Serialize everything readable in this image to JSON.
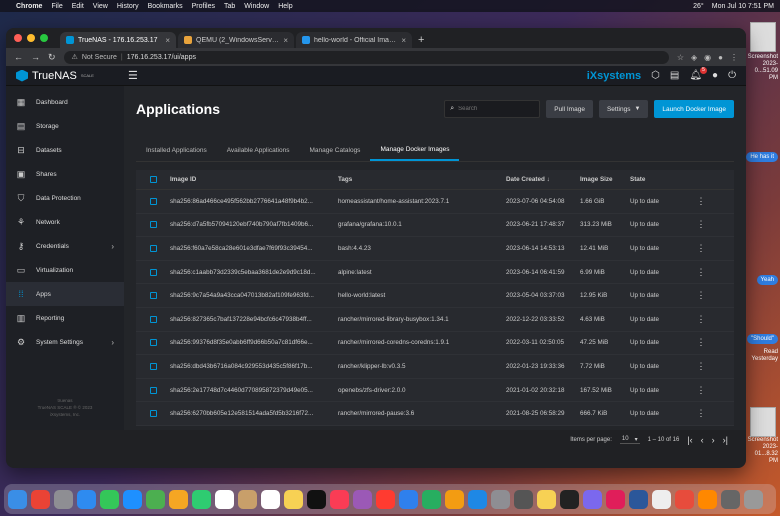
{
  "menubar": {
    "app": "Chrome",
    "items": [
      "File",
      "Edit",
      "View",
      "History",
      "Bookmarks",
      "Profiles",
      "Tab",
      "Window",
      "Help"
    ],
    "temperature": "26°",
    "datetime": "Mon Jul 10 7:51 PM"
  },
  "desktop": {
    "labels": [
      "Screenshot 2023-0...51.09 PM",
      "Screenshot 2023-01...8.32 PM"
    ],
    "chat": [
      "He has it",
      "Yeah",
      "\"Should\"",
      "Read Yesterday"
    ]
  },
  "browser": {
    "tabs": [
      {
        "label": "TrueNAS - 176.16.253.17",
        "active": true
      },
      {
        "label": "QEMU (2_WindowsServer2022...",
        "active": false
      },
      {
        "label": "hello-world - Official Image | D...",
        "active": false
      }
    ],
    "url_security": "Not Secure",
    "url": "176.16.253.17/ui/apps"
  },
  "header": {
    "logo_name": "TrueNAS",
    "logo_sub": "SCALE",
    "brand": "iXsystems",
    "notifications_count": "5"
  },
  "sidebar": {
    "items": [
      {
        "label": "Dashboard",
        "icon": "dashboard-icon"
      },
      {
        "label": "Storage",
        "icon": "storage-icon"
      },
      {
        "label": "Datasets",
        "icon": "datasets-icon"
      },
      {
        "label": "Shares",
        "icon": "shares-icon"
      },
      {
        "label": "Data Protection",
        "icon": "shield-icon"
      },
      {
        "label": "Network",
        "icon": "network-icon"
      },
      {
        "label": "Credentials",
        "icon": "key-icon"
      },
      {
        "label": "Virtualization",
        "icon": "monitor-icon"
      },
      {
        "label": "Apps",
        "icon": "apps-icon"
      },
      {
        "label": "Reporting",
        "icon": "chart-icon"
      },
      {
        "label": "System Settings",
        "icon": "gear-icon"
      }
    ],
    "footer_host": "truenas",
    "footer_version": "TrueNAS SCALE ® © 2023",
    "footer_company": "iXsystems, Inc."
  },
  "main": {
    "title": "Applications",
    "search_placeholder": "Search",
    "pull_image": "Pull Image",
    "settings": "Settings",
    "launch": "Launch Docker Image",
    "tabs": [
      "Installed Applications",
      "Available Applications",
      "Manage Catalogs",
      "Manage Docker Images"
    ],
    "columns": [
      "Image ID",
      "Tags",
      "Date Created",
      "Image Size",
      "State"
    ],
    "rows": [
      {
        "id": "sha256:86ad466ce495f562bb2776641a48f9b4b2...",
        "tags": "homeassistant/home-assistant:2023.7.1",
        "date": "2023-07-06 04:54:08",
        "size": "1.66 GiB",
        "state": "Up to date"
      },
      {
        "id": "sha256:d7a5fb57094120ebf740b790af7fb1409b6...",
        "tags": "grafana/grafana:10.0.1",
        "date": "2023-06-21 17:48:37",
        "size": "313.23 MiB",
        "state": "Up to date"
      },
      {
        "id": "sha256:f60a7e58ca28e601e3dfae7f69f93c39454...",
        "tags": "bash:4.4.23",
        "date": "2023-06-14 14:53:13",
        "size": "12.41 MiB",
        "state": "Up to date"
      },
      {
        "id": "sha256:c1aabb73d2339c5ebaa3681de2e9d9c18d...",
        "tags": "alpine:latest",
        "date": "2023-06-14 06:41:59",
        "size": "6.99 MiB",
        "state": "Up to date"
      },
      {
        "id": "sha256:9c7a54a9a43cca047013b82af109fe963fd...",
        "tags": "hello-world:latest",
        "date": "2023-05-04 03:37:03",
        "size": "12.95 KiB",
        "state": "Up to date"
      },
      {
        "id": "sha256:827365c7baf137228e94bcfc6c47938b4ff...",
        "tags": "rancher/mirrored-library-busybox:1.34.1",
        "date": "2022-12-22 03:33:52",
        "size": "4.63 MiB",
        "state": "Up to date"
      },
      {
        "id": "sha256:99376d8f35e0abb6ff9d66b50a7c81df66e...",
        "tags": "rancher/mirrored-coredns-coredns:1.9.1",
        "date": "2022-03-11 02:50:05",
        "size": "47.25 MiB",
        "state": "Up to date"
      },
      {
        "id": "sha256:dbd43b6716a084c929553d435c5f86f17b...",
        "tags": "rancher/klipper-lb:v0.3.5",
        "date": "2022-01-23 19:33:36",
        "size": "7.72 MiB",
        "state": "Up to date"
      },
      {
        "id": "sha256:2e17748d7c4460d770895872379d49e05...",
        "tags": "openebs/zfs-driver:2.0.0",
        "date": "2021-01-02 20:32:18",
        "size": "167.52 MiB",
        "state": "Up to date"
      },
      {
        "id": "sha256:6270bb605e12e581514ada5fd5b3216f72...",
        "tags": "rancher/mirrored-pause:3.6",
        "date": "2021-08-25 06:58:29",
        "size": "666.7 KiB",
        "state": "Up to date"
      }
    ],
    "paginator": {
      "label": "Items per page:",
      "per_page": "10",
      "range": "1 – 10 of 16"
    }
  },
  "colors": {
    "accent": "#0095d5"
  }
}
